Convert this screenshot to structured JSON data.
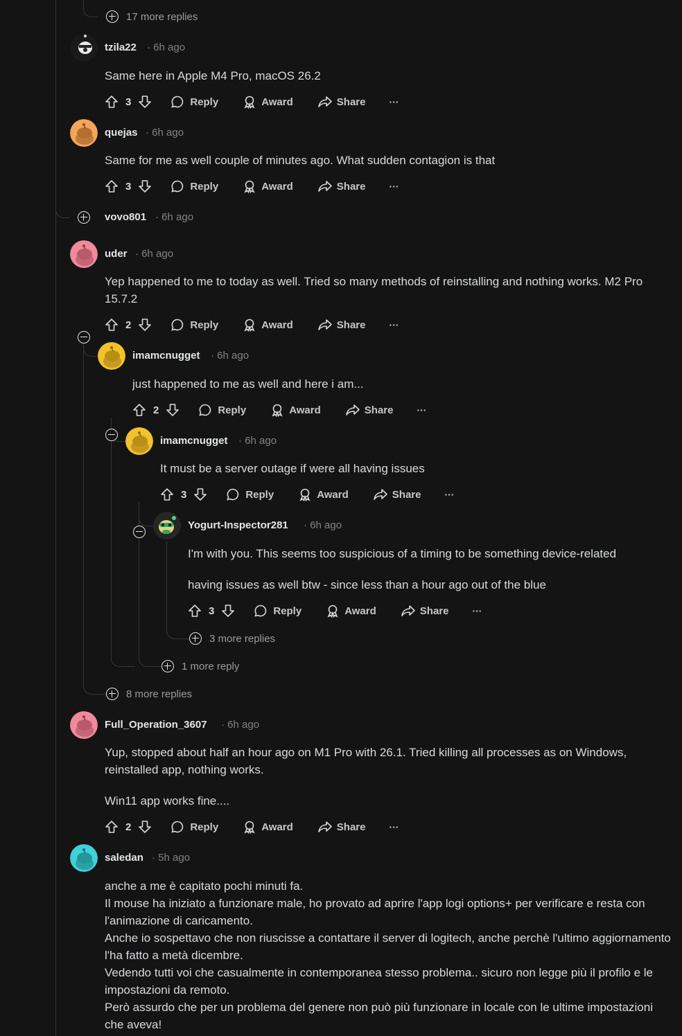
{
  "labels": {
    "reply": "Reply",
    "award": "Award",
    "share": "Share",
    "more": "···"
  },
  "top_more": "17 more replies",
  "comments": [
    {
      "user": "tzila22",
      "time": "6h ago",
      "body": "Same here in Apple M4 Pro, macOS 26.2",
      "votes": "3"
    },
    {
      "user": "quejas",
      "time": "6h ago",
      "body": "Same for me as well couple of minutes ago. What sudden contagion is that",
      "votes": "3"
    },
    {
      "user": "vovo801",
      "time": "6h ago"
    },
    {
      "user": "uder",
      "time": "6h ago",
      "body": "Yep happened to me to today as well. Tried so many methods of reinstalling and nothing works. M2 Pro 15.7.2",
      "votes": "2"
    },
    {
      "user": "imamcnugget",
      "time": "6h ago",
      "body": "just happened to me as well and here i am...",
      "votes": "2"
    },
    {
      "user": "imamcnugget",
      "time": "6h ago",
      "body": "It must be a server outage if were all having issues",
      "votes": "3"
    },
    {
      "user": "Yogurt-Inspector281",
      "time": "6h ago",
      "body": "I'm with you. This seems too suspicious of a timing to be something device-related",
      "body2": "having issues as well btw - since less than a hour ago out of the blue",
      "votes": "3"
    },
    {
      "user": "Full_Operation_3607",
      "time": "6h ago",
      "body": "Yup, stopped about half an hour ago on M1 Pro with 26.1. Tried killing all processes as on Windows, reinstalled app, nothing works.",
      "body2": "Win11 app works fine....",
      "votes": "2"
    },
    {
      "user": "saledan",
      "time": "5h ago",
      "body": "anche a me è capitato pochi minuti fa.\nIl mouse ha iniziato a funzionare male, ho provato ad aprire l'app logi options+ per verificare e resta con l'animazione di caricamento.\nAnche io sospettavo che non riuscisse a contattare il server di logitech, anche perchè l'ultimo aggiornamento l'ha fatto a metà dicembre.\nVedendo tutti voi che casualmente in contemporanea stesso problema.. sicuro non legge più il profilo e le impostazioni da remoto.\nPerò assurdo che per un problema del genere non può più funzionare in locale con le ultime impostazioni che aveva!"
    }
  ],
  "more_replies": {
    "yogurt": "3 more replies",
    "mcnugget": "1 more reply",
    "uder": "8 more replies"
  },
  "colors": {
    "bg": "#141414",
    "avatar_orange": "#f5a45b",
    "avatar_pink": "#f08a9a",
    "avatar_yellow": "#f2c12e",
    "avatar_cyan": "#3ed1d8"
  }
}
